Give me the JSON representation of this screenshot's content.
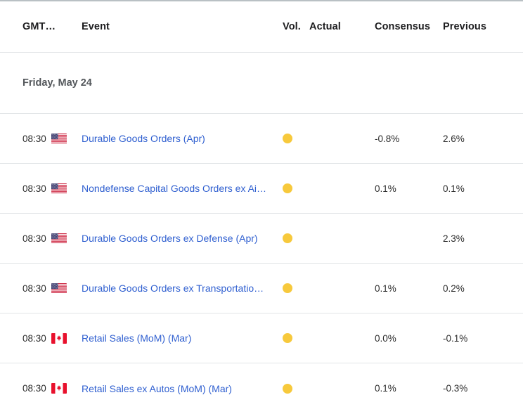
{
  "table": {
    "columns": {
      "time": "GMT…",
      "event": "Event",
      "vol": "Vol.",
      "actual": "Actual",
      "consensus": "Consensus",
      "previous": "Previous"
    },
    "date_group": "Friday, May 24",
    "rows": [
      {
        "time": "08:30",
        "flag": "us-flag-icon",
        "country": "United States",
        "event": "Durable Goods Orders (Apr)",
        "volatility": "medium",
        "volatility_color": "#f7c93c",
        "actual": "",
        "consensus": "-0.8%",
        "previous": "2.6%"
      },
      {
        "time": "08:30",
        "flag": "us-flag-icon",
        "country": "United States",
        "event": "Nondefense Capital Goods Orders ex Ai…",
        "volatility": "medium",
        "volatility_color": "#f7c93c",
        "actual": "",
        "consensus": "0.1%",
        "previous": "0.1%"
      },
      {
        "time": "08:30",
        "flag": "us-flag-icon",
        "country": "United States",
        "event": "Durable Goods Orders ex Defense (Apr)",
        "volatility": "medium",
        "volatility_color": "#f7c93c",
        "actual": "",
        "consensus": "",
        "previous": "2.3%"
      },
      {
        "time": "08:30",
        "flag": "us-flag-icon",
        "country": "United States",
        "event": "Durable Goods Orders ex Transportatio…",
        "volatility": "medium",
        "volatility_color": "#f7c93c",
        "actual": "",
        "consensus": "0.1%",
        "previous": "0.2%"
      },
      {
        "time": "08:30",
        "flag": "ca-flag-icon",
        "country": "Canada",
        "event": "Retail Sales (MoM) (Mar)",
        "volatility": "medium",
        "volatility_color": "#f7c93c",
        "actual": "",
        "consensus": "0.0%",
        "previous": "-0.1%"
      },
      {
        "time": "08:30",
        "flag": "ca-flag-icon",
        "country": "Canada",
        "event": "Retail Sales ex Autos (MoM) (Mar)",
        "volatility": "medium",
        "volatility_color": "#f7c93c",
        "actual": "",
        "consensus": "0.1%",
        "previous": "-0.3%"
      }
    ]
  }
}
